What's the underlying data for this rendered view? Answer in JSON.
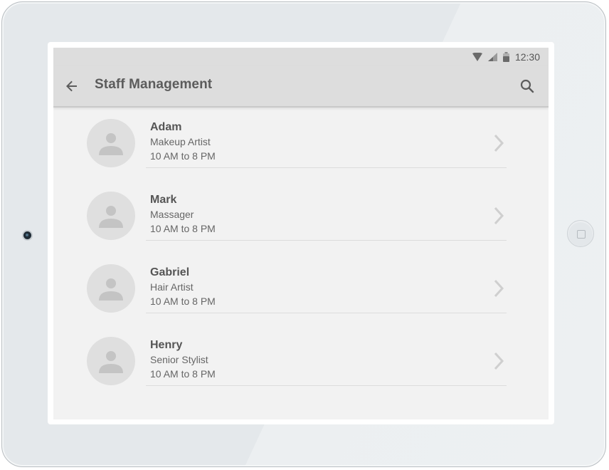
{
  "status_bar": {
    "time": "12:30",
    "icons": [
      "wifi-icon",
      "signal-icon",
      "battery-icon"
    ]
  },
  "app_bar": {
    "title": "Staff Management",
    "back_icon": "arrow-left-icon",
    "search_icon": "search-icon"
  },
  "staff": [
    {
      "name": "Adam",
      "role": "Makeup Artist",
      "hours": "10 AM to 8 PM"
    },
    {
      "name": "Mark",
      "role": "Massager",
      "hours": "10 AM to 8 PM"
    },
    {
      "name": "Gabriel",
      "role": "Hair Artist",
      "hours": "10 AM to 8 PM"
    },
    {
      "name": "Henry",
      "role": "Senior Stylist",
      "hours": "10 AM to 8 PM"
    }
  ],
  "colors": {
    "app_bar_bg": "#dddddd",
    "screen_bg": "#f2f2f2",
    "avatar_bg": "#dfdfdf",
    "text_primary": "#555555"
  }
}
